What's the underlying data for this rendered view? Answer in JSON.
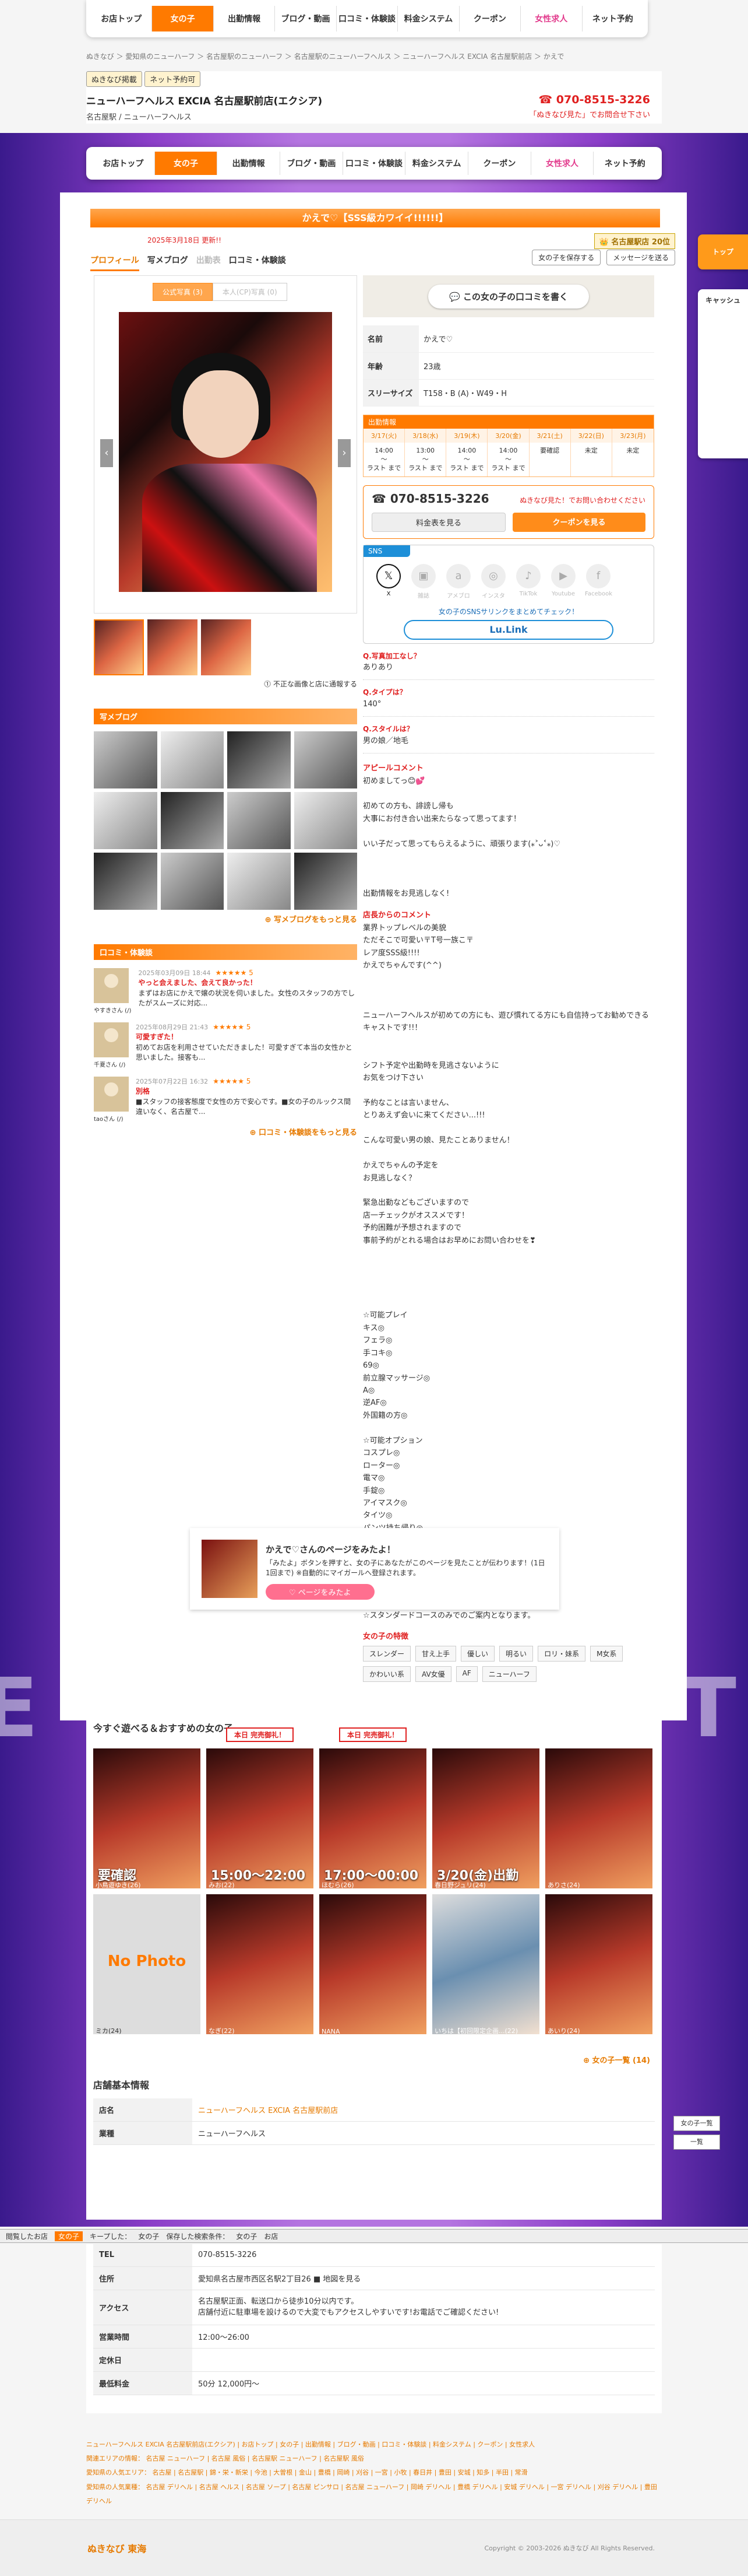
{
  "nav": [
    "お店トップ",
    "女の子",
    "出勤情報",
    "ブログ・動画",
    "口コミ・体験談",
    "料金システム",
    "クーポン",
    "女性求人",
    "ネット予約"
  ],
  "breadcrumb": "ぬきなび ＞ 愛知県のニューハーフ ＞ 名古屋駅のニューハーフ ＞ 名古屋駅のニューハーフヘルス ＞ ニューハーフヘルス EXCIA 名古屋駅前店 ＞ かえで",
  "shop": {
    "badge1": "ぬきなび掲載",
    "badge2": "ネット予約可",
    "name": "ニューハーフヘルス EXCIA 名古屋駅前店(エクシア)",
    "sub": "名古屋駅 / ニューハーフヘルス",
    "tel": "070-8515-3226",
    "tel_note": "「ぬきなび見た」でお問合せ下さい"
  },
  "profile": {
    "title": "かえで♡【SSS級カワイイ!!!!!!】",
    "updated": "2025年3月18日 更新!!",
    "rank": "名古屋駅店 20位",
    "tabs": [
      "プロフィール",
      "写メブログ",
      "出勤表",
      "口コミ・体験談"
    ],
    "fav_btn": "女の子を保存する",
    "msg_btn": "メッセージを送る",
    "photo_tabs": [
      "公式写真 (3)",
      "本人(CP)写真 (0)"
    ],
    "photo_note": "不正な画像と店に通報する",
    "review_btn": "この女の子の口コミを書く",
    "fields": [
      {
        "k": "名前",
        "v": "かえで♡"
      },
      {
        "k": "年齢",
        "v": "23歳"
      },
      {
        "k": "スリーサイズ",
        "v": "T158・B (A)・W49・H"
      }
    ],
    "schedule_title": "出勤情報",
    "schedule": [
      {
        "d": "3/17(火)",
        "t": "14:00\n〜\nラスト まで"
      },
      {
        "d": "3/18(水)",
        "t": "13:00\n〜\nラスト まで"
      },
      {
        "d": "3/19(木)",
        "t": "14:00\n〜\nラスト まで"
      },
      {
        "d": "3/20(金)",
        "t": "14:00\n〜\nラスト まで"
      },
      {
        "d": "3/21(土)",
        "t": "要確認"
      },
      {
        "d": "3/22(日)",
        "t": "未定"
      },
      {
        "d": "3/23(月)",
        "t": "未定"
      }
    ],
    "contact_tel": "070-8515-3226",
    "contact_note": "ぬきなび見た！でお問い合わせください",
    "contact_btn1": "料金表を見る",
    "contact_btn2": "クーポンを見る",
    "sns_head": "SNS",
    "sns": [
      "X",
      "雑誌",
      "アメブロ",
      "インスタ",
      "TikTok",
      "Youtube",
      "Facebook"
    ],
    "sns_msg": "女の子のSNSサリンクをまとめてチェック！",
    "lulink": "Lu.Link",
    "blog_head": "写メブログ",
    "blog_more": "写メブログをもっと見る",
    "review_head": "口コミ・体験談",
    "reviews": [
      {
        "date": "2025年03月09日 18:44",
        "stars": "★★★★★ 5",
        "title": "やっと会えました、会えて良かった！",
        "text": "まずはお店にかえで嬢の状況を伺いました。女性のスタッフの方でしたがスムーズに対応...",
        "user": "やすきさん (/)"
      },
      {
        "date": "2025年08月29日 21:43",
        "stars": "★★★★★ 5",
        "title": "可愛すぎた！",
        "text": "初めてお店を利用させていただきました！可愛すぎて本当の女性かと思いました。接客も...",
        "user": "千夏さん (/)"
      },
      {
        "date": "2025年07月22日 16:32",
        "stars": "★★★★★ 5",
        "title": "別格",
        "text": "■スタッフの接客態度で女性の方で安心です。■女の子のルックス間違いなく、名古屋で...",
        "user": "taoさん (/)"
      }
    ],
    "review_more": "口コミ・体験談をもっと見る",
    "qa": [
      {
        "q": "Q.写真加工なし？",
        "a": "ありあり"
      },
      {
        "q": "Q.タイプは？",
        "a": "140°"
      },
      {
        "q": "Q.スタイルは？",
        "a": "男の娘／地毛"
      }
    ],
    "appeal_title": "アピールコメント",
    "appeal": "初めましてっ😊💕\n\n初めての方も、誹謗し帰も\n大事にお付き合い出来たらなって思ってます！\n\nいい子だって思ってもらえるように、頑張ります(⁎˃ᴗ˂⁎)♡\n\n\n\n出勤情報をお見逃しなく!",
    "shop_title": "店長からのコメント",
    "shop_comment": "業界トップレベルの美貌\nただそこで可愛い〒T号一族こ〒\nレア度SSS級!!!!\nかえでちゃんです(^^)\n\n\n\nニューハーフヘルスが初めての方にも、遊び慣れてる方にも自信持ってお勧めできるキャストです!!！\n\n\nシフト予定や出勤時を見逃さないように\nお気をつけ下さい\n\n予約なことは言いません、\nとりあえず会いに来てください...!!!\n\nこんな可愛い男の娘、見たことありません！\n\nかえでちゃんの予定を\nお見逃しなく？\n\n緊急出勤などもございますので\n店一チェックがオススメです！\n予約困難が予想されますので\n事前予約がとれる場合はお早めにお問い合わせを❣\n\n\n\n\n\n☆可能プレイ\nキス◎\nフェラ◎\n手コキ◎\n69◎\n前立腺マッサージ◎\nA◎\n逆AF◎\n外国籍の方◎\n\n☆可能オプション\nコスプレ◎\nローター◎\n電マ◎\n手錠◎\nアイマスク◎\nタイツ◎\nパンツ持ち帰り◎\nオナニー鑑賞◎\n放尿◎\n聖水◎\n写真撮影可◎\n動画撮影◎\n\n☆スタンダードコースのみでのご案内となります。",
    "feature_title": "女の子の特徴",
    "features": [
      "スレンダー",
      "甘え上手",
      "優しい",
      "明るい",
      "ロリ・妹系",
      "M女系",
      "かわいい系",
      "AV女優",
      "AF",
      "ニューハーフ"
    ]
  },
  "banner": {
    "title": "かえで♡さんのページをみたよ！",
    "text": "「みたよ」ボタンを押すと、女の子にあなたがこのページを見たことが伝わります！(1日1回まで) ※自動的にマイガールへ登録されます。",
    "btn": "ページをみたよ"
  },
  "recommend": {
    "title": "今すぐ遊べる＆おすすめの女の子",
    "today": "本日 完売御礼！",
    "cards": [
      {
        "lbl": "要確認",
        "nm": "小鳥遊ゆき(26)"
      },
      {
        "lbl": "15:00〜22:00",
        "nm": "みお(22)"
      },
      {
        "lbl": "17:00〜00:00",
        "nm": "ほむら(26)"
      },
      {
        "lbl": "3/20(金)出勤",
        "nm": "春日野ジュリ(24)"
      },
      {
        "lbl": "",
        "nm": "ありさ(24)"
      },
      {
        "lbl": "",
        "nm": "ミカ(24)"
      },
      {
        "lbl": "",
        "nm": "なぎ(22)"
      },
      {
        "lbl": "",
        "nm": "NANA"
      },
      {
        "lbl": "",
        "nm": "いちは【初回限定企画...(22)"
      },
      {
        "lbl": "",
        "nm": "あいり(24)"
      }
    ],
    "no_photo": "No Photo",
    "more": "女の子一覧 (14)"
  },
  "shopinfo": {
    "title": "店舗基本情報",
    "rows": [
      {
        "k": "店名",
        "v": "ニューハーフヘルス EXCIA 名古屋駅前店"
      },
      {
        "k": "業種",
        "v": "ニューハーフヘルス"
      },
      {
        "k": "TEL",
        "v": "070-8515-3226"
      },
      {
        "k": "住所",
        "v": "愛知県名古屋市西区名駅2丁目26 ■ 地図を見る"
      },
      {
        "k": "アクセス",
        "v": "名古屋駅正面、転送口から徒歩10分以内です。\n店舗付近に駐車場を設けるので大変でもアクセスしやすいです!お電話でご確認ください!"
      },
      {
        "k": "営業時間",
        "v": "12:00〜26:00"
      },
      {
        "k": "定休日",
        "v": ""
      },
      {
        "k": "最低料金",
        "v": "50分 12,000円〜"
      }
    ]
  },
  "bottombar": [
    "閲覧したお店",
    "女の子",
    "キープした：",
    "女の子",
    "保存した検索条件：",
    "女の子",
    "お店"
  ],
  "footer": {
    "links1": "ニューハーフヘルス EXCIA 名古屋駅前店(エクシア) | お店トップ | 女の子 | 出勤情報 | ブログ・動画 | 口コミ・体験談 | 料金システム | クーポン | 女性求人",
    "links2": "関連エリアの情報： 名古屋 ニューハーフ | 名古屋 風俗 | 名古屋駅 ニューハーフ | 名古屋駅 風俗",
    "links3": "愛知県の人気エリア： 名古屋 | 名古屋駅 | 錦・栄・新栄 | 今池 | 大曽根 | 金山 | 豊橋 | 岡崎 | 刈谷 | 一宮 | 小牧 | 春日井 | 豊田 | 安城 | 知多 | 半田 | 常滑",
    "links4": "愛知県の人気業種： 名古屋 デリヘル | 名古屋 ヘルス | 名古屋 ソープ | 名古屋 ピンサロ | 名古屋 ニューハーフ | 岡崎 デリヘル | 豊橋 デリヘル | 安城 デリヘル | 一宮 デリヘル | 刈谷 デリヘル | 豊田 デリヘル",
    "logo": "ぬきなび 東海",
    "copy": "Copyright © 2003-2026 ぬきなび All Rights Reserved."
  },
  "side": {
    "top": "トップ",
    "cash": "キャッシュ",
    "pagetop": "女の子一覧",
    "back": "一覧"
  }
}
